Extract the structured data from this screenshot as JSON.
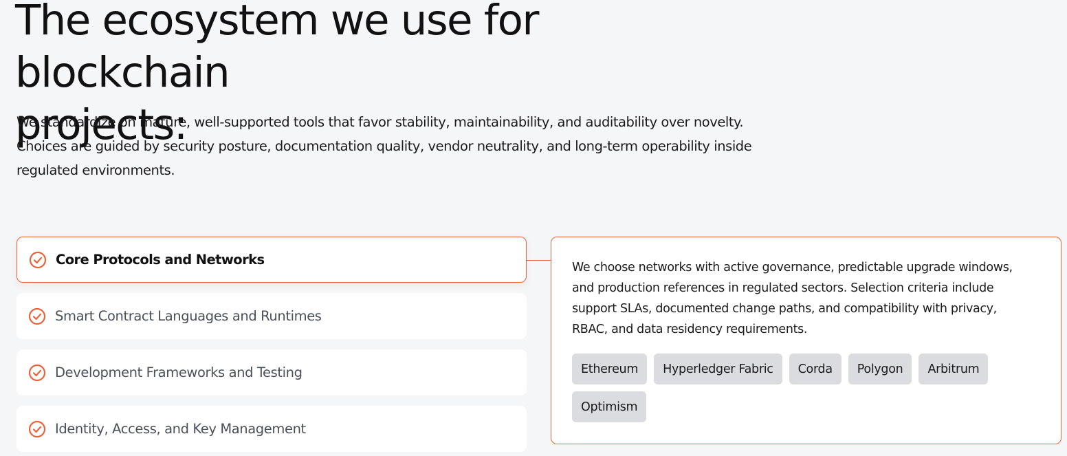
{
  "heading": {
    "line1": "The ecosystem we use for blockchain",
    "line2": "projects:"
  },
  "intro": {
    "line1": "We standardize on mature, well-supported tools that favor stability, maintainability, and auditability over novelty.",
    "line2": "Choices are guided by security posture, documentation quality, vendor neutrality, and long-term operability inside",
    "line3": "regulated environments."
  },
  "accordion": {
    "items": [
      {
        "label": "Core Protocols and Networks",
        "active": true
      },
      {
        "label": "Smart Contract Languages and Runtimes",
        "active": false
      },
      {
        "label": "Development Frameworks and Testing",
        "active": false
      },
      {
        "label": "Identity, Access, and Key Management",
        "active": false
      }
    ],
    "icon": "check-circle-icon"
  },
  "detail": {
    "description_lines": [
      "We choose networks with active governance, predictable upgrade windows,",
      "and production references in regulated sectors. Selection criteria include",
      "support SLAs, documented change paths, and compatibility with privacy,",
      "RBAC, and data residency requirements."
    ],
    "tags": [
      "Ethereum",
      "Hyperledger Fabric",
      "Corda",
      "Polygon",
      "Arbitrum",
      "Optimism"
    ]
  },
  "colors": {
    "accent": "#e8633a",
    "background": "#f5f6f8",
    "card": "#ffffff",
    "tag_bg": "#dadcdf",
    "heading": "#111111",
    "muted_label": "#4a4f58"
  }
}
